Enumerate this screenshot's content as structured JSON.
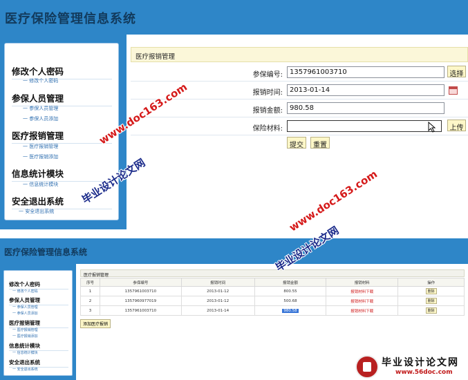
{
  "app_title": "医疗保险管理信息系统",
  "sidebar": {
    "sections": [
      {
        "heading": "修改个人密码",
        "items": [
          "修改个人密码"
        ]
      },
      {
        "heading": "参保人员管理",
        "items": [
          "参保人员管理",
          "参保人员添加"
        ]
      },
      {
        "heading": "医疗报销管理",
        "items": [
          "医疗报销管理",
          "医疗报销添加"
        ]
      },
      {
        "heading": "信息统计模块",
        "items": [
          "信息统计模块"
        ]
      },
      {
        "heading": "安全退出系统",
        "items": [
          "安全退出系统"
        ]
      }
    ]
  },
  "form_view": {
    "panel_title": "医疗报销管理",
    "fields": {
      "insured_id": {
        "label": "参保编号:",
        "value": "1357961003710",
        "button": "选择"
      },
      "date": {
        "label": "报销时间:",
        "value": "2013-01-14"
      },
      "amount": {
        "label": "报销金额:",
        "value": "980.58"
      },
      "material": {
        "label": "保险材料:",
        "value": "",
        "button": "上传"
      }
    },
    "submit_label": "提交",
    "reset_label": "重置"
  },
  "list_view": {
    "panel_title": "医疗报销管理",
    "columns": [
      "序号",
      "参保编号",
      "报销时间",
      "报销金额",
      "报销材料",
      "操作"
    ],
    "rows": [
      {
        "no": "1",
        "id": "1357961003710",
        "date": "2013-01-12",
        "amount": "800.55",
        "material": "报销材料下载",
        "action": "删除"
      },
      {
        "no": "2",
        "id": "1357960977019",
        "date": "2013-01-12",
        "amount": "500.68",
        "material": "报销材料下载",
        "action": "删除"
      },
      {
        "no": "3",
        "id": "1357961003710",
        "date": "2013-01-14",
        "amount": "980.58",
        "material": "报销材料下载",
        "action": "删除"
      }
    ],
    "add_label": "添加医疗报销"
  },
  "watermarks": {
    "url": "www.doc163.com",
    "cn": "毕业设计论文网",
    "logo_name": "毕业设计论文网",
    "logo_url": "www.56doc.com"
  }
}
